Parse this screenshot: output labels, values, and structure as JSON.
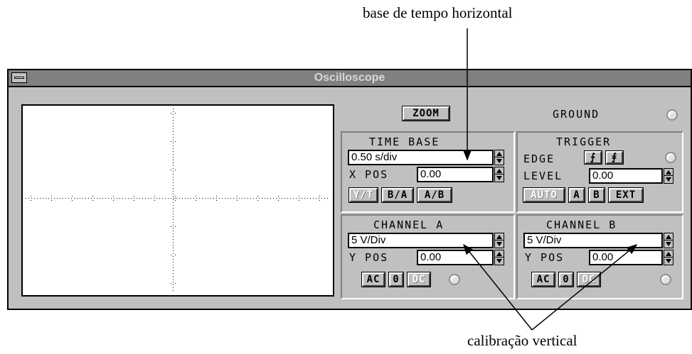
{
  "annotations": {
    "time_base": "base de tempo horizontal",
    "vertical": "calibração vertical"
  },
  "window": {
    "title": "Oscilloscope"
  },
  "zoom_label": "ZOOM",
  "ground_label": "GROUND",
  "time_base": {
    "header": "TIME BASE",
    "value": "0.50 s/div",
    "xpos_label": "X POS",
    "xpos_value": "0.00",
    "buttons": [
      "Y/T",
      "B/A",
      "A/B"
    ]
  },
  "trigger": {
    "header": "TRIGGER",
    "edge_label": "EDGE",
    "level_label": "LEVEL",
    "level_value": "0.00",
    "buttons": [
      "AUTO",
      "A",
      "B",
      "EXT"
    ]
  },
  "channel_a": {
    "header": "CHANNEL A",
    "value": "5 V/Div",
    "ypos_label": "Y POS",
    "ypos_value": "0.00",
    "buttons": [
      "AC",
      "0",
      "DC"
    ]
  },
  "channel_b": {
    "header": "CHANNEL B",
    "value": "5 V/Div",
    "ypos_label": "Y POS",
    "ypos_value": "0.00",
    "buttons": [
      "AC",
      "0",
      "DC"
    ]
  },
  "icons": [
    "minimize-icon",
    "rising-edge-icon",
    "falling-edge-icon",
    "led-icon",
    "spin-arrows-icon"
  ]
}
